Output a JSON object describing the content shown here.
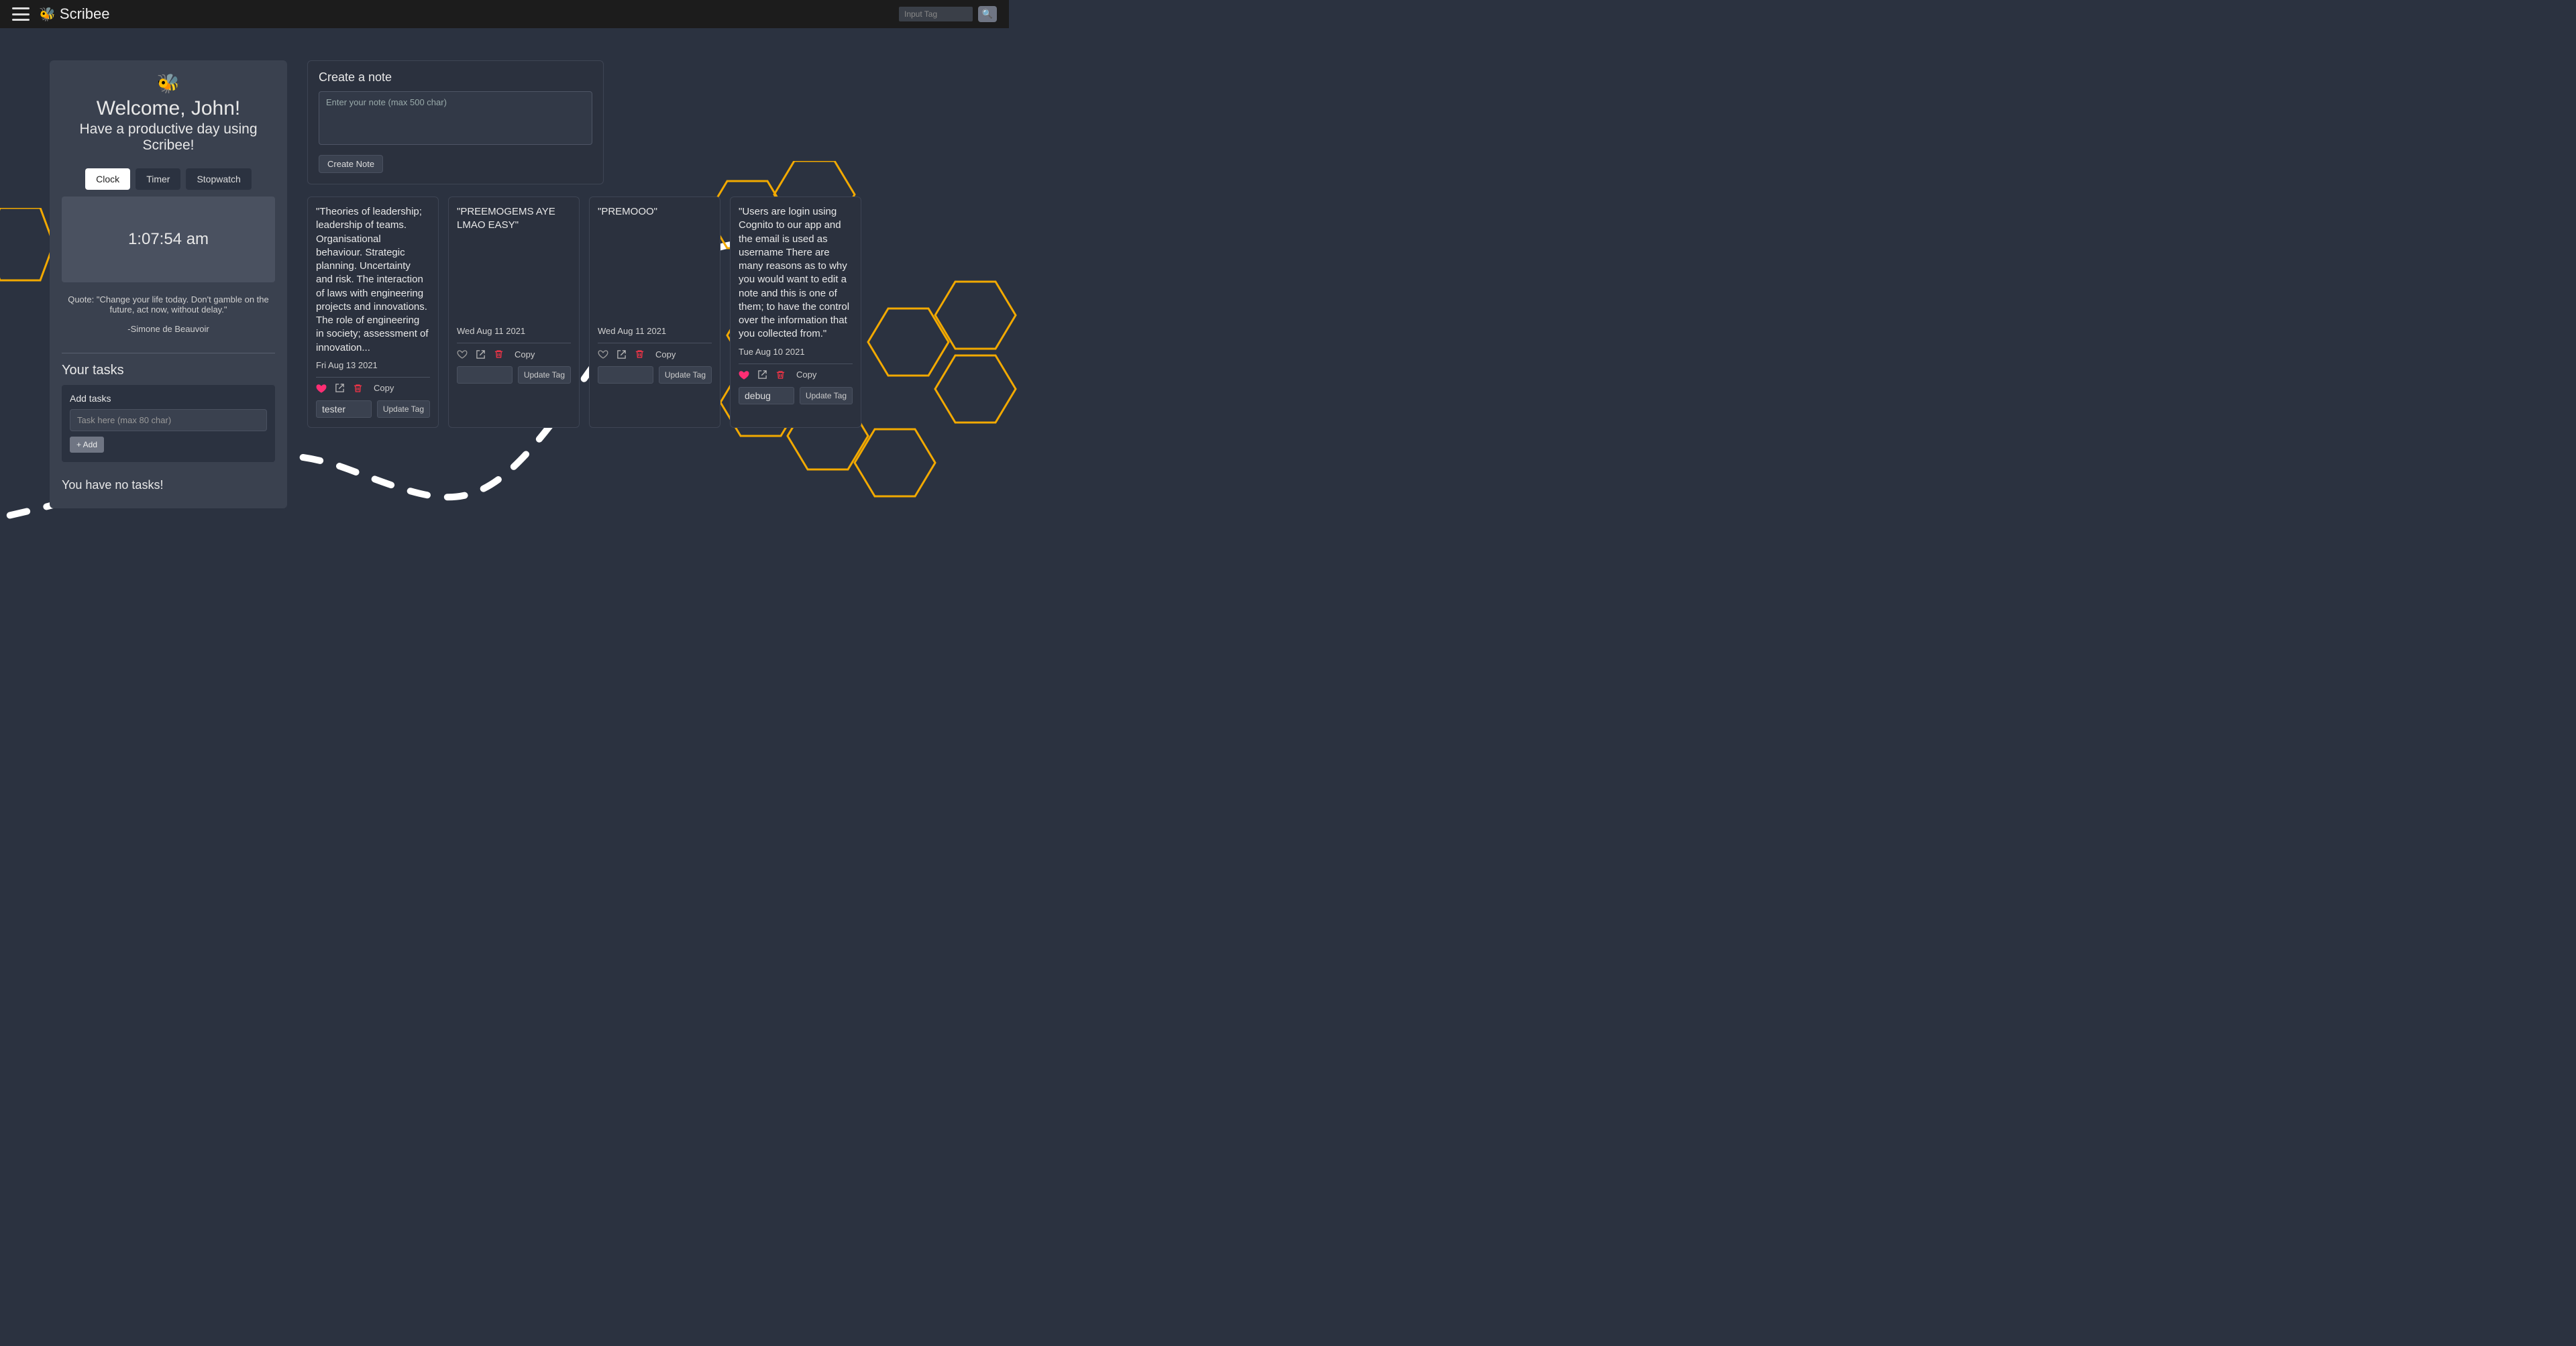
{
  "app": {
    "name": "Scribee"
  },
  "nav": {
    "search_placeholder": "Input Tag"
  },
  "sidebar": {
    "welcome_title": "Welcome, John!",
    "welcome_sub": "Have a productive day using Scribee!",
    "tabs": {
      "clock": "Clock",
      "timer": "Timer",
      "stopwatch": "Stopwatch"
    },
    "clock_time": "1:07:54 am",
    "quote_text": "Quote: \"Change your life today. Don't gamble on the future, act now, without delay.\"",
    "quote_author": "-Simone de Beauvoir",
    "tasks_heading": "Your tasks",
    "add_tasks_label": "Add tasks",
    "task_placeholder": "Task here (max 80 char)",
    "add_btn": "+ Add",
    "no_tasks": "You have no tasks!"
  },
  "create": {
    "heading": "Create a note",
    "placeholder": "Enter your note (max 500 char)",
    "button": "Create Note"
  },
  "labels": {
    "copy": "Copy",
    "update_tag": "Update Tag"
  },
  "notes": [
    {
      "text": "\"Theories of leadership; leadership of teams. Organisational behaviour. Strategic planning. Uncertainty and risk. The interaction of laws with engineering projects and innovations. The role of engineering in society; assessment of innovation...",
      "date": "Fri Aug 13 2021",
      "fav": true,
      "tag": "tester"
    },
    {
      "text": "\"PREEMOGEMS AYE LMAO EASY\"",
      "date": "Wed Aug 11 2021",
      "fav": false,
      "tag": ""
    },
    {
      "text": "\"PREMOOO\"",
      "date": "Wed Aug 11 2021",
      "fav": false,
      "tag": ""
    },
    {
      "text": "\"Users are login using Cognito to our app and the email is used as username There are many reasons as to why you would want to edit a note and this is one of them; to have the control over the information that you collected from.\"",
      "date": "Tue Aug 10 2021",
      "fav": true,
      "tag": "debug"
    }
  ]
}
